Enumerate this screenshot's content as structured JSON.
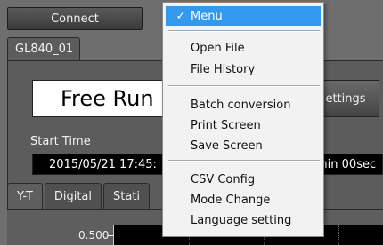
{
  "toolbar": {
    "connect_label": "Connect"
  },
  "device": {
    "tab_label": "GL840_01"
  },
  "mode": {
    "value": "Free Run",
    "settings_label": "ettings"
  },
  "start": {
    "label": "Start Time",
    "time_value": "2015/05/21 17:45:",
    "duration_value": "min 00sec"
  },
  "view_tabs": [
    {
      "label": "Y-T"
    },
    {
      "label": "Digital"
    },
    {
      "label": "Stati"
    }
  ],
  "plot": {
    "y_tick_label": "0.500"
  },
  "menu": {
    "items": [
      {
        "label": "Menu",
        "checked": true
      },
      {
        "label": "Open File"
      },
      {
        "label": "File History"
      },
      {
        "label": "Batch conversion"
      },
      {
        "label": "Print Screen"
      },
      {
        "label": "Save Screen"
      },
      {
        "label": "CSV Config"
      },
      {
        "label": "Mode Change"
      },
      {
        "label": "Language setting"
      }
    ],
    "check_glyph": "✓"
  },
  "colors": {
    "menu_highlight": "#3399ee",
    "background": "#6e6e6e"
  }
}
